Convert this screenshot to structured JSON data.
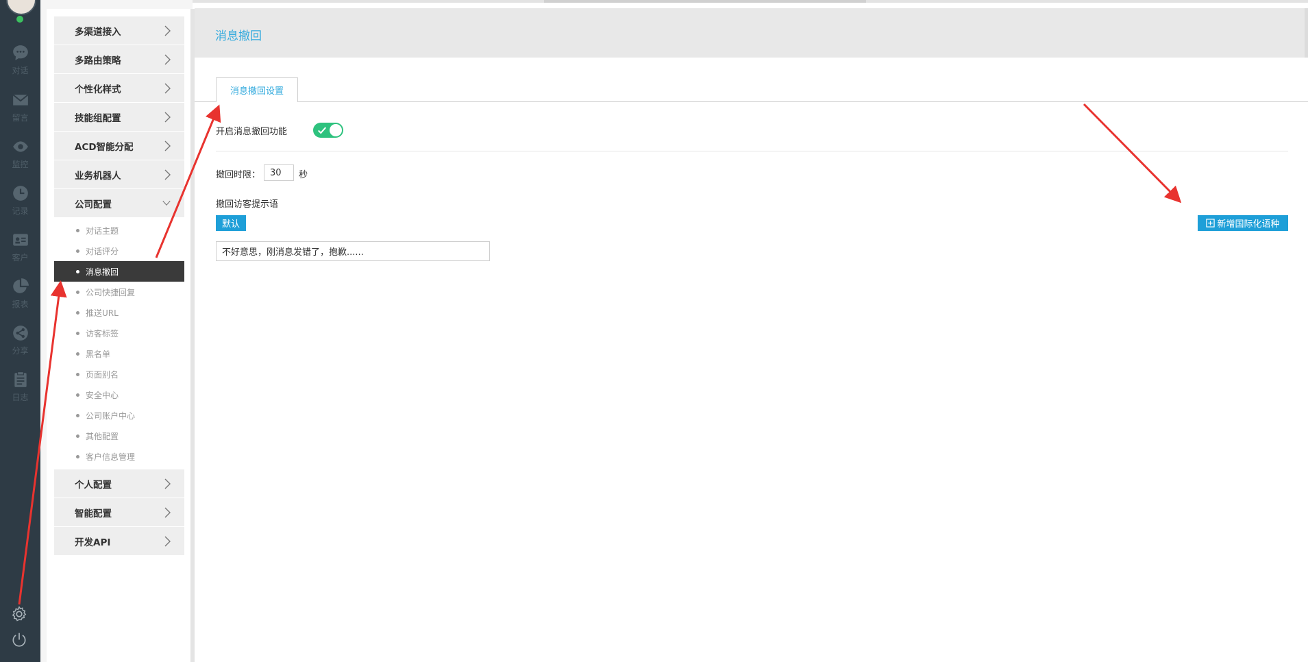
{
  "sidebar_rail": {
    "items": [
      {
        "label": "对话",
        "icon": "chat-bubble-icon"
      },
      {
        "label": "留言",
        "icon": "envelope-icon"
      },
      {
        "label": "监控",
        "icon": "eye-icon"
      },
      {
        "label": "记录",
        "icon": "clock-icon"
      },
      {
        "label": "客户",
        "icon": "id-card-icon"
      },
      {
        "label": "报表",
        "icon": "pie-chart-icon"
      },
      {
        "label": "分享",
        "icon": "share-icon"
      },
      {
        "label": "日志",
        "icon": "clipboard-icon"
      }
    ],
    "bottom_icons": [
      "gear-icon",
      "power-icon"
    ]
  },
  "menu": {
    "groups_top": [
      {
        "label": "多渠道接入"
      },
      {
        "label": "多路由策略"
      },
      {
        "label": "个性化样式"
      },
      {
        "label": "技能组配置"
      },
      {
        "label": "ACD智能分配"
      },
      {
        "label": "业务机器人"
      }
    ],
    "open_group": {
      "label": "公司配置",
      "items": [
        {
          "label": "对话主题",
          "active": false
        },
        {
          "label": "对话评分",
          "active": false
        },
        {
          "label": "消息撤回",
          "active": true
        },
        {
          "label": "公司快捷回复",
          "active": false
        },
        {
          "label": "推送URL",
          "active": false
        },
        {
          "label": "访客标签",
          "active": false
        },
        {
          "label": "黑名单",
          "active": false
        },
        {
          "label": "页面别名",
          "active": false
        },
        {
          "label": "安全中心",
          "active": false
        },
        {
          "label": "公司账户中心",
          "active": false
        },
        {
          "label": "其他配置",
          "active": false
        },
        {
          "label": "客户信息管理",
          "active": false
        }
      ]
    },
    "groups_bottom": [
      {
        "label": "个人配置"
      },
      {
        "label": "智能配置"
      },
      {
        "label": "开发API"
      }
    ]
  },
  "main": {
    "title": "消息撤回",
    "tab": "消息撤回设置",
    "enable_label": "开启消息撤回功能",
    "enable_on": true,
    "time_limit_label": "撤回时限：",
    "time_limit_value": "30",
    "time_unit": "秒",
    "visitor_prompt_label": "撤回访客提示语",
    "default_badge": "默认",
    "add_language_button": "新增国际化语种",
    "prompt_text": "不好意思，刚消息发错了，抱歉......"
  },
  "colors": {
    "accent": "#1e9fd8",
    "title_blue": "#30a9dd",
    "toggle_on": "#2ec27e",
    "rail": "#2e3b45",
    "annotation_arrow": "#e8332f"
  }
}
